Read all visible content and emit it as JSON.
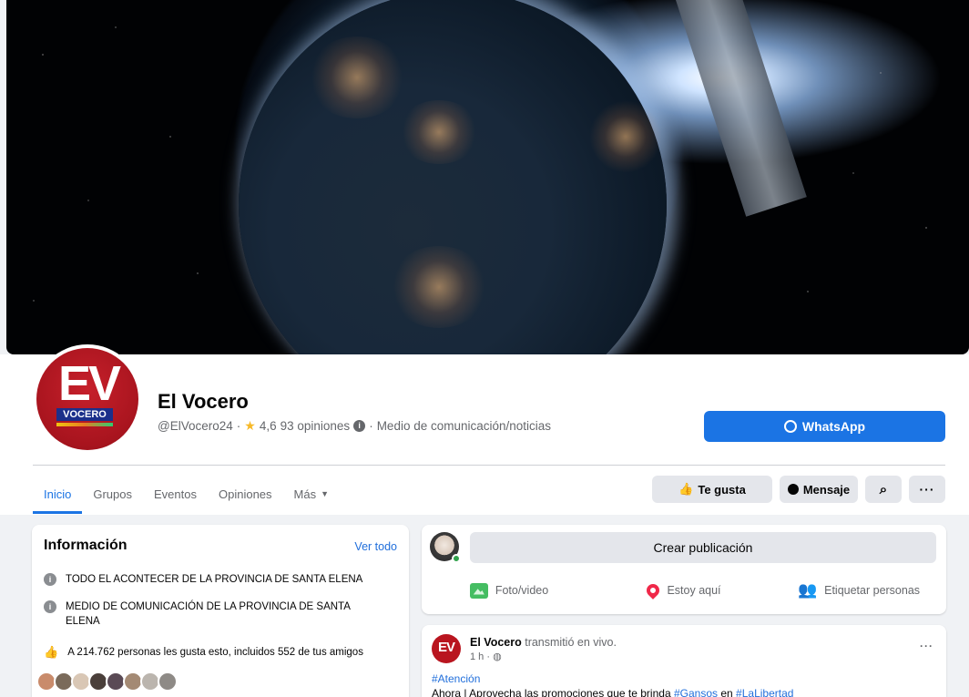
{
  "page": {
    "name": "El Vocero",
    "handle": "@ElVocero24",
    "rating": "4,6",
    "reviews": "93 opiniones",
    "category": "Medio de comunicación/noticias",
    "avatar_text": "EV",
    "avatar_subtext": "VOCERO"
  },
  "buttons": {
    "whatsapp": "WhatsApp",
    "like": "Te gusta",
    "message": "Mensaje"
  },
  "tabs": [
    {
      "label": "Inicio"
    },
    {
      "label": "Grupos"
    },
    {
      "label": "Eventos"
    },
    {
      "label": "Opiniones"
    },
    {
      "label": "Más"
    }
  ],
  "info": {
    "title": "Información",
    "see_all": "Ver todo",
    "line1": "TODO EL ACONTECER DE LA PROVINCIA DE SANTA ELENA",
    "line2": "MEDIO DE COMUNICACIÓN DE LA PROVINCIA DE SANTA ELENA",
    "likes": "A 214.762 personas les gusta esto, incluidos 552 de tus amigos"
  },
  "create_post": {
    "prompt": "Crear publicación",
    "photo": "Foto/video",
    "location": "Estoy aquí",
    "tag": "Etiquetar personas"
  },
  "post": {
    "author": "El Vocero",
    "action": "transmitió en vivo.",
    "time": "1 h ·",
    "hashtag": "#Atención",
    "text_start": "Ahora | Aprovecha las promociones que te brinda",
    "link1": "#Gansos",
    "text_mid": "en",
    "link2": "#LaLibertad",
    "avatar_text": "EV"
  },
  "colors": {
    "accent": "#1b74e4",
    "brand_red": "#b9151f"
  }
}
